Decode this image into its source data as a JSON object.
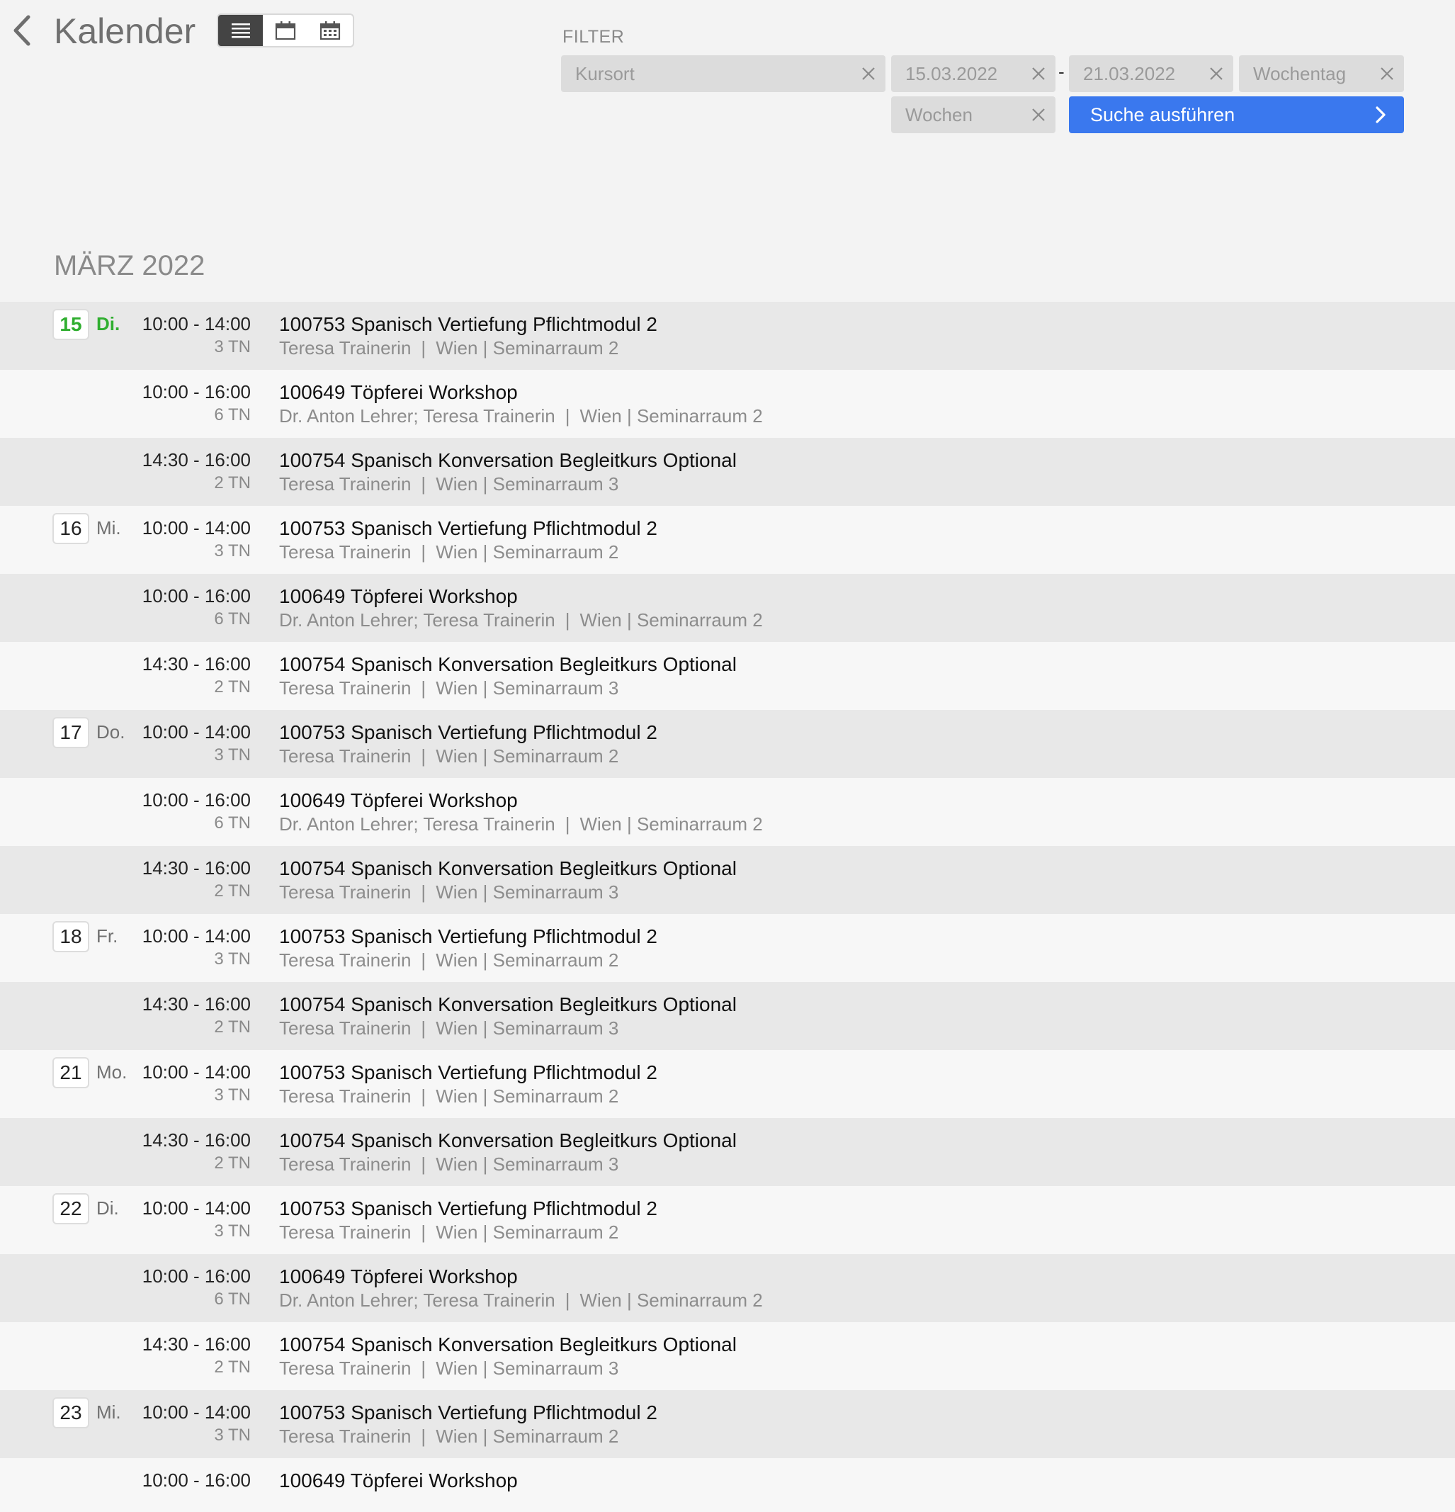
{
  "header": {
    "title": "Kalender",
    "month_heading": "MÄRZ 2022",
    "view_toggle": {
      "active": "list-view",
      "options": [
        "list-view",
        "week-view",
        "month-view"
      ]
    }
  },
  "filter": {
    "label": "FILTER",
    "kursort_placeholder": "Kursort",
    "date_from": "15.03.2022",
    "date_separator": "-",
    "date_to": "21.03.2022",
    "wochentag_placeholder": "Wochentag",
    "wochen_placeholder": "Wochen",
    "search_label": "Suche ausführen"
  },
  "colors": {
    "accent": "#3a78ee",
    "today": "#2fae2f",
    "row_odd": "#e8e8e8",
    "row_even": "#f7f7f7"
  },
  "events": [
    {
      "day": "15",
      "weekday": "Di.",
      "today": true,
      "time": "10:00 - 14:00",
      "participants": "3 TN",
      "title": "100753 Spanisch Vertiefung Pflichtmodul 2",
      "trainer": "Teresa Trainerin",
      "location": "Wien | Seminarraum 2"
    },
    {
      "day": "",
      "weekday": "",
      "today": false,
      "time": "10:00 - 16:00",
      "participants": "6 TN",
      "title": "100649 Töpferei Workshop",
      "trainer": "Dr. Anton Lehrer; Teresa Trainerin",
      "location": "Wien | Seminarraum 2"
    },
    {
      "day": "",
      "weekday": "",
      "today": false,
      "time": "14:30 - 16:00",
      "participants": "2 TN",
      "title": "100754 Spanisch Konversation Begleitkurs Optional",
      "trainer": "Teresa Trainerin",
      "location": "Wien | Seminarraum 3"
    },
    {
      "day": "16",
      "weekday": "Mi.",
      "today": false,
      "time": "10:00 - 14:00",
      "participants": "3 TN",
      "title": "100753 Spanisch Vertiefung Pflichtmodul 2",
      "trainer": "Teresa Trainerin",
      "location": "Wien | Seminarraum 2"
    },
    {
      "day": "",
      "weekday": "",
      "today": false,
      "time": "10:00 - 16:00",
      "participants": "6 TN",
      "title": "100649 Töpferei Workshop",
      "trainer": "Dr. Anton Lehrer; Teresa Trainerin",
      "location": "Wien | Seminarraum 2"
    },
    {
      "day": "",
      "weekday": "",
      "today": false,
      "time": "14:30 - 16:00",
      "participants": "2 TN",
      "title": "100754 Spanisch Konversation Begleitkurs Optional",
      "trainer": "Teresa Trainerin",
      "location": "Wien | Seminarraum 3"
    },
    {
      "day": "17",
      "weekday": "Do.",
      "today": false,
      "time": "10:00 - 14:00",
      "participants": "3 TN",
      "title": "100753 Spanisch Vertiefung Pflichtmodul 2",
      "trainer": "Teresa Trainerin",
      "location": "Wien | Seminarraum 2"
    },
    {
      "day": "",
      "weekday": "",
      "today": false,
      "time": "10:00 - 16:00",
      "participants": "6 TN",
      "title": "100649 Töpferei Workshop",
      "trainer": "Dr. Anton Lehrer; Teresa Trainerin",
      "location": "Wien | Seminarraum 2"
    },
    {
      "day": "",
      "weekday": "",
      "today": false,
      "time": "14:30 - 16:00",
      "participants": "2 TN",
      "title": "100754 Spanisch Konversation Begleitkurs Optional",
      "trainer": "Teresa Trainerin",
      "location": "Wien | Seminarraum 3"
    },
    {
      "day": "18",
      "weekday": "Fr.",
      "today": false,
      "time": "10:00 - 14:00",
      "participants": "3 TN",
      "title": "100753 Spanisch Vertiefung Pflichtmodul 2",
      "trainer": "Teresa Trainerin",
      "location": "Wien | Seminarraum 2"
    },
    {
      "day": "",
      "weekday": "",
      "today": false,
      "time": "14:30 - 16:00",
      "participants": "2 TN",
      "title": "100754 Spanisch Konversation Begleitkurs Optional",
      "trainer": "Teresa Trainerin",
      "location": "Wien | Seminarraum 3"
    },
    {
      "day": "21",
      "weekday": "Mo.",
      "today": false,
      "time": "10:00 - 14:00",
      "participants": "3 TN",
      "title": "100753 Spanisch Vertiefung Pflichtmodul 2",
      "trainer": "Teresa Trainerin",
      "location": "Wien | Seminarraum 2"
    },
    {
      "day": "",
      "weekday": "",
      "today": false,
      "time": "14:30 - 16:00",
      "participants": "2 TN",
      "title": "100754 Spanisch Konversation Begleitkurs Optional",
      "trainer": "Teresa Trainerin",
      "location": "Wien | Seminarraum 3"
    },
    {
      "day": "22",
      "weekday": "Di.",
      "today": false,
      "time": "10:00 - 14:00",
      "participants": "3 TN",
      "title": "100753 Spanisch Vertiefung Pflichtmodul 2",
      "trainer": "Teresa Trainerin",
      "location": "Wien | Seminarraum 2"
    },
    {
      "day": "",
      "weekday": "",
      "today": false,
      "time": "10:00 - 16:00",
      "participants": "6 TN",
      "title": "100649 Töpferei Workshop",
      "trainer": "Dr. Anton Lehrer; Teresa Trainerin",
      "location": "Wien | Seminarraum 2"
    },
    {
      "day": "",
      "weekday": "",
      "today": false,
      "time": "14:30 - 16:00",
      "participants": "2 TN",
      "title": "100754 Spanisch Konversation Begleitkurs Optional",
      "trainer": "Teresa Trainerin",
      "location": "Wien | Seminarraum 3"
    },
    {
      "day": "23",
      "weekday": "Mi.",
      "today": false,
      "time": "10:00 - 14:00",
      "participants": "3 TN",
      "title": "100753 Spanisch Vertiefung Pflichtmodul 2",
      "trainer": "Teresa Trainerin",
      "location": "Wien | Seminarraum 2"
    },
    {
      "day": "",
      "weekday": "",
      "today": false,
      "time": "10:00 - 16:00",
      "participants": "",
      "title": "100649 Töpferei Workshop",
      "trainer": "",
      "location": ""
    }
  ]
}
